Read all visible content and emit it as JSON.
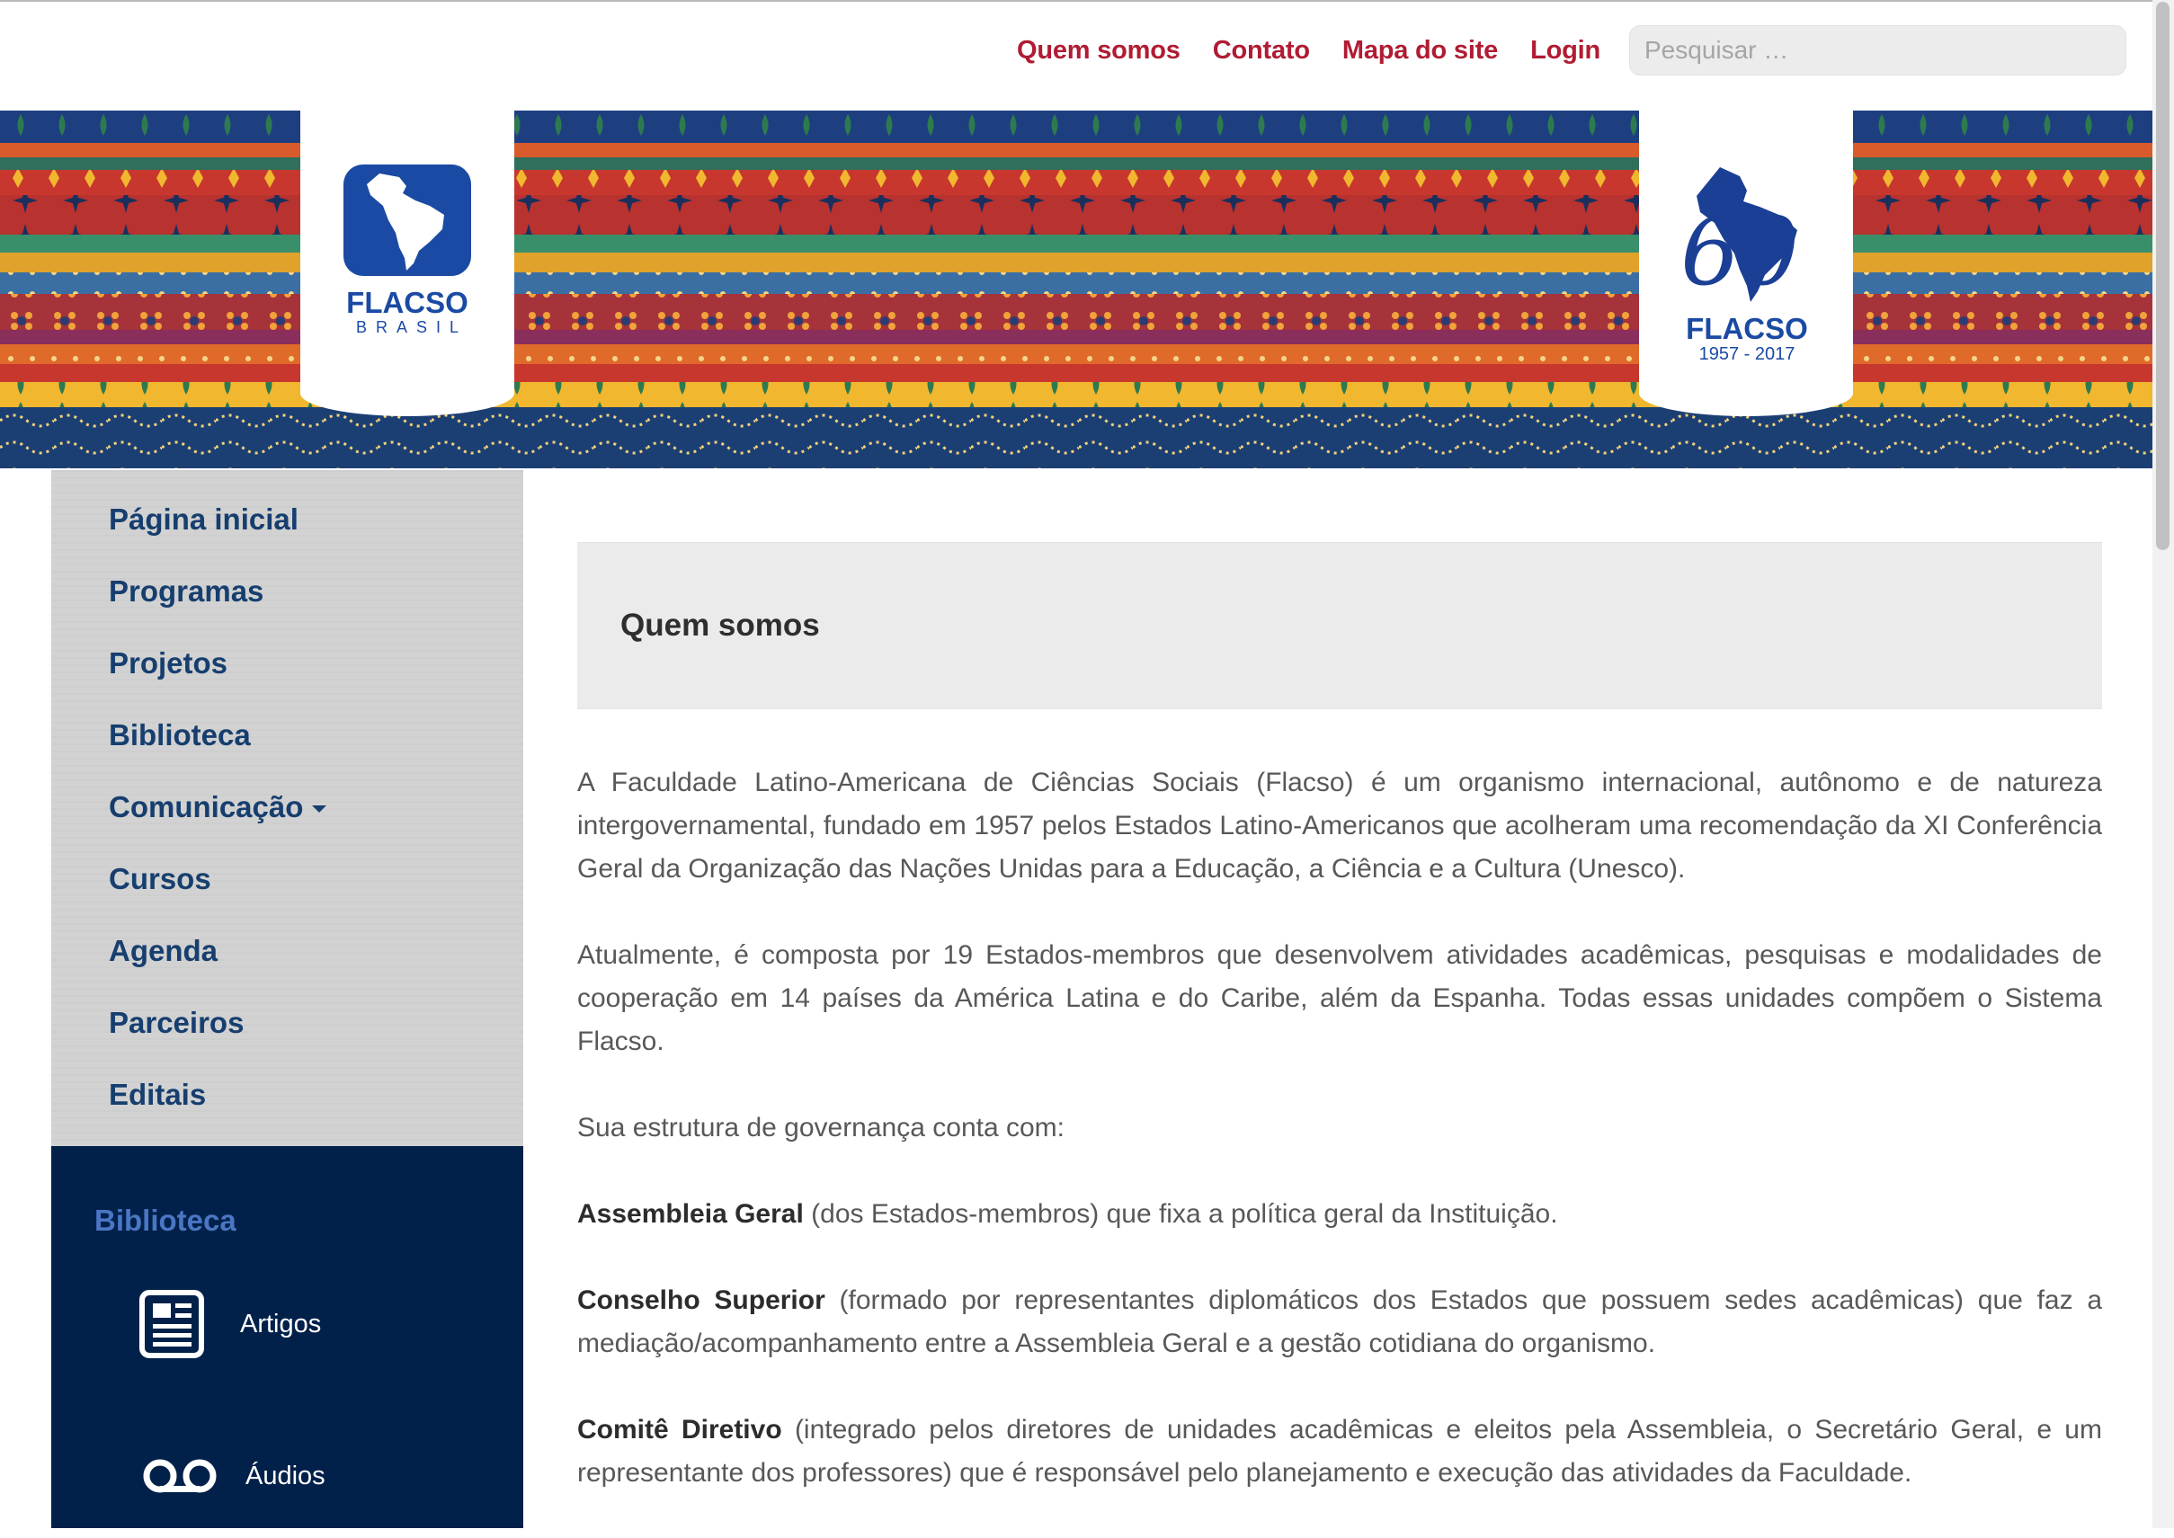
{
  "topnav": {
    "links": [
      "Quem somos",
      "Contato",
      "Mapa do site",
      "Login"
    ],
    "search_placeholder": "Pesquisar …"
  },
  "banner": {
    "left_logo": {
      "name": "FLACSO",
      "sub": "BRASIL"
    },
    "right_logo": {
      "number": "60",
      "name": "FLACSO",
      "years": "1957 - 2017"
    },
    "stripe_colors": [
      "#c8372d",
      "#1d4b8f",
      "#f0b72f",
      "#3a8f6b",
      "#8a2e5c",
      "#e06a2a"
    ]
  },
  "sidebar": {
    "menu": [
      "Página inicial",
      "Programas",
      "Projetos",
      "Biblioteca",
      "Comunicação",
      "Cursos",
      "Agenda",
      "Parceiros",
      "Editais"
    ],
    "panel": {
      "title": "Biblioteca",
      "items": [
        {
          "label": "Artigos",
          "icon": "newspaper-icon"
        },
        {
          "label": "Áudios",
          "icon": "voicemail-icon"
        }
      ]
    }
  },
  "main": {
    "title": "Quem somos",
    "p1": "A Faculdade Latino-Americana de Ciências Sociais (Flacso) é um organismo internacional, autônomo e de natureza intergovernamental, fundado em 1957 pelos Estados Latino-Americanos que acolheram uma recomendação da XI Conferência Geral da Organização das Nações Unidas para a Educação, a Ciência e a Cultura (Unesco).",
    "p2": "Atualmente, é composta por 19 Estados-membros que desenvolvem atividades acadêmicas, pesquisas e modalidades de cooperação em 14 países da América Latina e do Caribe, além da Espanha. Todas essas unidades compõem o Sistema Flacso.",
    "p3": "Sua estrutura de governança conta com:",
    "items": [
      {
        "bold": "Assembleia Geral",
        "text": " (dos Estados-membros) que fixa a política geral da Instituição."
      },
      {
        "bold": "Conselho Superior",
        "text": " (formado por representantes diplomáticos dos Estados que possuem sedes acadêmicas) que faz a mediação/acompanhamento entre a Assembleia Geral e a gestão cotidiana do organismo."
      },
      {
        "bold": "Comitê Diretivo",
        "text": " (integrado pelos diretores de unidades acadêmicas e eleitos pela Assembleia, o Secretário Geral, e um representante dos professores) que é responsável pelo planejamento e execução das atividades da Faculdade."
      }
    ]
  },
  "colors": {
    "topnav_link": "#b01c33",
    "menu_text": "#163e6e",
    "panel_bg": "#02214a",
    "panel_title": "#4a76c4",
    "logo_blue": "#1a4aa3"
  }
}
